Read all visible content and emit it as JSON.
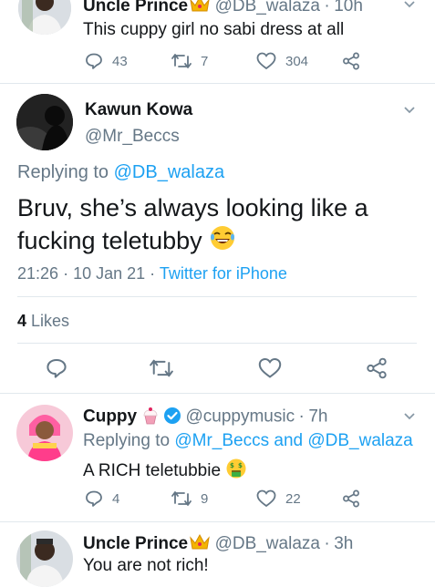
{
  "tweets": [
    {
      "name": "Uncle Prince",
      "handle": "@DB_walaza",
      "sep": "·",
      "time": "10h",
      "text": "This cuppy girl no sabi dress at all",
      "replies": "43",
      "retweets": "7",
      "likes": "304"
    },
    {
      "name": "Cuppy",
      "handle": "@cuppymusic",
      "sep": "·",
      "time": "7h",
      "replying_prefix": "Replying to",
      "replying_to": "@Mr_Beccs and @DB_walaza",
      "text": "A RICH teletubbie",
      "replies": "4",
      "retweets": "9",
      "likes": "22"
    },
    {
      "name": "Uncle Prince",
      "handle": "@DB_walaza",
      "sep": "·",
      "time": "3h",
      "text": "You are not rich!"
    }
  ],
  "main_tweet": {
    "name": "Kawun Kowa",
    "handle": "@Mr_Beccs",
    "replying_prefix": "Replying to",
    "replying_handle": "@DB_walaza",
    "text_line1": "Bruv, she’s always looking like a",
    "text_line2": "fucking teletubby",
    "time": "21:26",
    "sep1": "·",
    "date": "10 Jan 21",
    "sep2": "·",
    "source": "Twitter for iPhone",
    "likes_count": "4",
    "likes_label": "Likes"
  },
  "icons": {
    "reply": "reply-icon",
    "retweet": "retweet-icon",
    "like": "heart-icon",
    "share": "share-icon",
    "more": "chevron-down-icon",
    "verified": "verified-badge-icon",
    "crown": "crown-emoji",
    "cupcake": "cupcake-emoji",
    "laugh": "laughing-emoji",
    "money": "money-mouth-emoji"
  },
  "colors": {
    "link": "#1da1f2",
    "muted": "#657786",
    "text": "#14171a",
    "divider": "#e1e8ed"
  }
}
